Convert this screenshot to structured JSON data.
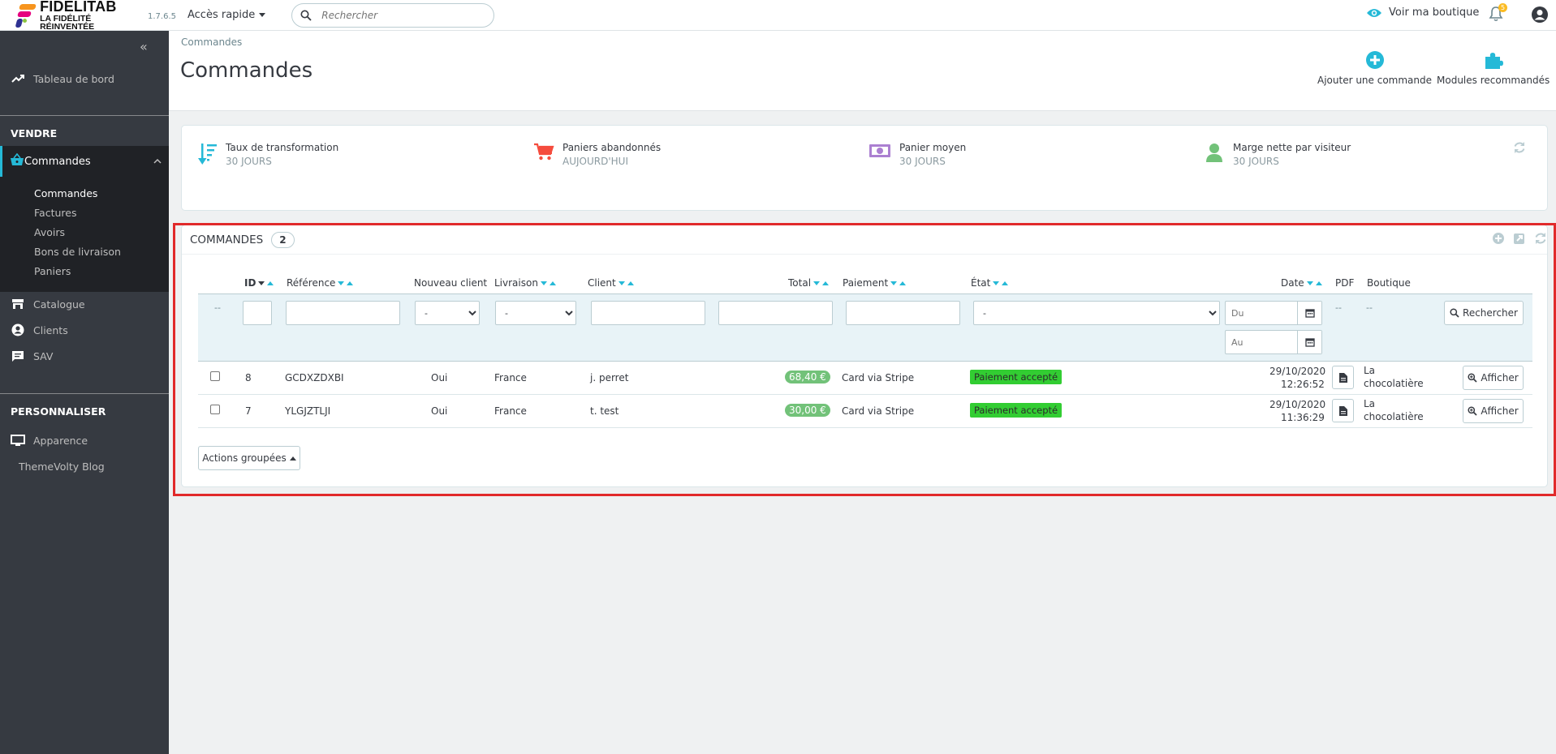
{
  "header": {
    "logo_line1": "FIDELITAB",
    "logo_line2": "LA FIDÉLITÉ RÉINVENTÉE",
    "version": "1.7.6.5",
    "quick_access": "Accès rapide",
    "search_placeholder": "Rechercher",
    "view_shop": "Voir ma boutique",
    "notif_count": "5",
    "colors": {
      "accent": "#25b9d7",
      "badge": "#fbbb22"
    }
  },
  "sidebar": {
    "dashboard": "Tableau de bord",
    "section_sell": "VENDRE",
    "orders": "Commandes",
    "orders_sub": [
      "Commandes",
      "Factures",
      "Avoirs",
      "Bons de livraison",
      "Paniers"
    ],
    "catalog": "Catalogue",
    "clients": "Clients",
    "sav": "SAV",
    "section_custom": "PERSONNALISER",
    "appearance": "Apparence",
    "blog": "ThemeVolty Blog"
  },
  "page": {
    "breadcrumb": "Commandes",
    "title": "Commandes",
    "add_order": "Ajouter une commande",
    "modules": "Modules recommandés"
  },
  "kpis": [
    {
      "title": "Taux de transformation",
      "sub": "30 JOURS",
      "icon": "sort-amount-icon",
      "color": "#25b9d7"
    },
    {
      "title": "Paniers abandonnés",
      "sub": "AUJOURD'HUI",
      "icon": "cart-icon",
      "color": "#f54c3e"
    },
    {
      "title": "Panier moyen",
      "sub": "30 JOURS",
      "icon": "money-icon",
      "color": "#ab7fd1"
    },
    {
      "title": "Marge nette par visiteur",
      "sub": "30 JOURS",
      "icon": "user-icon",
      "color": "#72c279"
    }
  ],
  "orders": {
    "panel_title": "COMMANDES",
    "count": "2",
    "columns": {
      "id": "ID",
      "reference": "Référence",
      "new_client": "Nouveau client",
      "delivery": "Livraison",
      "client": "Client",
      "total": "Total",
      "payment": "Paiement",
      "state": "État",
      "date": "Date",
      "pdf": "PDF",
      "shop": "Boutique"
    },
    "filters": {
      "bulk_dash": "--",
      "new_client_value": "-",
      "delivery_value": "-",
      "state_value": "-",
      "date_from": "Du",
      "date_to": "Au",
      "pdf_dash": "--",
      "shop_dash": "--",
      "search_button": "Rechercher"
    },
    "rows": [
      {
        "id": "8",
        "reference": "GCDXZDXBI",
        "new_client": "Oui",
        "delivery": "France",
        "client": "j. perret",
        "total": "68,40 €",
        "payment": "Card via Stripe",
        "state": "Paiement accepté",
        "date": "29/10/2020",
        "time": "12:26:52",
        "shop_line1": "La",
        "shop_line2": "chocolatière",
        "action": "Afficher"
      },
      {
        "id": "7",
        "reference": "YLGJZTLJI",
        "new_client": "Oui",
        "delivery": "France",
        "client": "t. test",
        "total": "30,00 €",
        "payment": "Card via Stripe",
        "state": "Paiement accepté",
        "date": "29/10/2020",
        "time": "11:36:29",
        "shop_line1": "La",
        "shop_line2": "chocolatière",
        "action": "Afficher"
      }
    ],
    "bulk_actions": "Actions groupées"
  }
}
